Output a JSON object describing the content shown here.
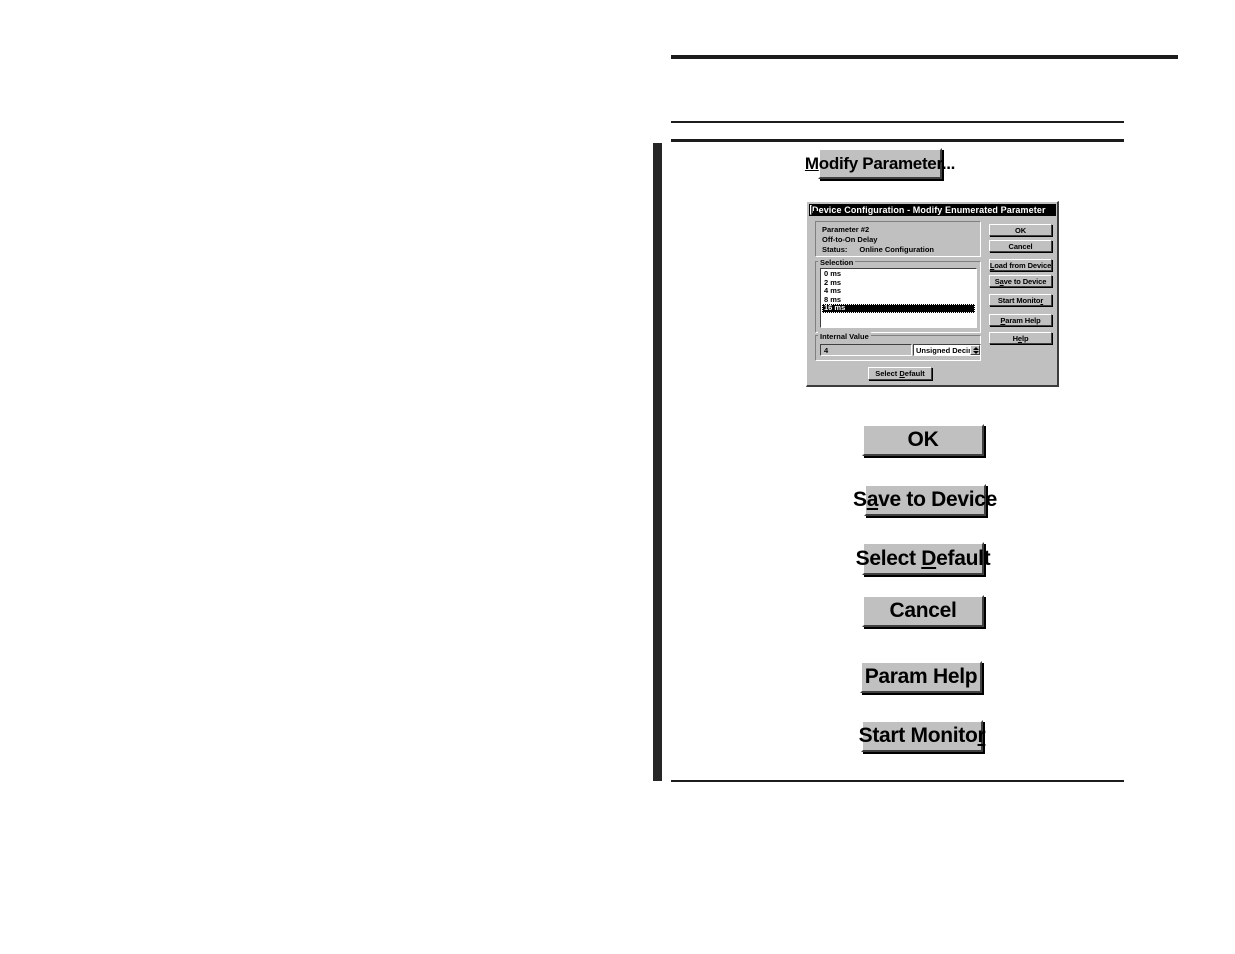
{
  "page": {
    "rules": [
      "top-rule",
      "mid-rule",
      "section-rule",
      "bottom-rule"
    ],
    "side_bar": "chapter-side-bar"
  },
  "callouts": {
    "modify_parameter": {
      "label": "Modify Parameter...",
      "prefix": "M",
      "rest": "odify Parameter..."
    },
    "ok": {
      "label": "OK",
      "prefix": "",
      "rest": "OK"
    },
    "save_to_device": {
      "label": "Save to Device",
      "before": "S",
      "prefix": "a",
      "rest": "ve to Device"
    },
    "select_default": {
      "label": "Select Default",
      "before": "Select ",
      "prefix": "D",
      "rest": "efault"
    },
    "cancel": {
      "label": "Cancel",
      "before": "",
      "prefix": "",
      "rest": "Cancel"
    },
    "param_help": {
      "label": "Param Help",
      "before": "",
      "prefix": "",
      "rest": "Param Help"
    },
    "start_monitor": {
      "label": "Start Monitor",
      "before": "Start Monito",
      "prefix": "r",
      "rest": ""
    }
  },
  "dialog": {
    "title": "Device Configuration - Modify Enumerated Parameter",
    "minimize_icon": "minimize-icon",
    "info": {
      "parameter": "Parameter #2",
      "name": "Off-to-On Delay",
      "status_label": "Status:",
      "status_value": "Online Configuration"
    },
    "selection": {
      "legend": "Selection",
      "items": [
        {
          "label": "0 ms",
          "selected": false
        },
        {
          "label": "2 ms",
          "selected": false
        },
        {
          "label": "4 ms",
          "selected": false
        },
        {
          "label": "8 ms",
          "selected": false
        },
        {
          "label": "16 ms",
          "selected": true
        }
      ]
    },
    "internal_value": {
      "label": "Internal Value",
      "value": "4",
      "format": "Unsigned Decimal",
      "format_options": [
        "Unsigned Decimal"
      ]
    },
    "select_default_button": "Select Default",
    "buttons": {
      "ok": "OK",
      "cancel": "Cancel",
      "load_from_device": "Load from Device",
      "save_to_device": "Save to Device",
      "start_monitor": "Start Monitor",
      "param_help": "Param Help",
      "help": "Help"
    }
  },
  "colors": {
    "face": "#c0c0c0",
    "shadow": "#404040",
    "highlight": "#ffffff",
    "title_bar": "#000000",
    "ink": "#1c1c1c"
  }
}
